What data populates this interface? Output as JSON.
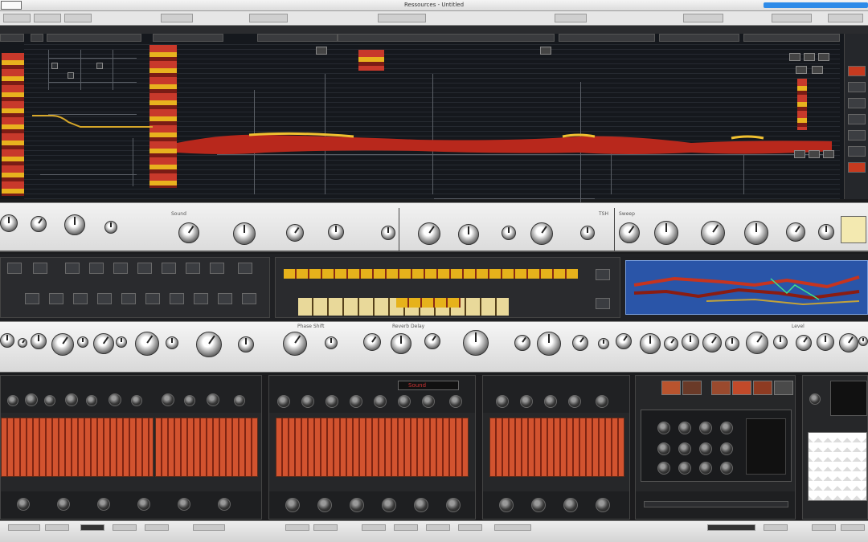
{
  "window": {
    "title": "Ressources - Untitled",
    "left_label": "Untitled",
    "accent": "#2e8be8"
  },
  "palette": {
    "clip_red": "#c8392b",
    "clip_yellow": "#e8b21e",
    "panel_dark": "#15181d",
    "panel_light": "#eeeeee",
    "sequencer_blue": "#2a55a8"
  },
  "icons": [
    "close-icon",
    "knob-icon",
    "fader-icon",
    "pad-icon",
    "record-icon"
  ],
  "rack_module_label": "Sound",
  "knob_row_1_labels": [
    "Sound",
    "Sweep",
    "TSH"
  ],
  "knob_row_2_labels": [
    "Phase Shift",
    "Reverb Delay",
    "Level"
  ]
}
